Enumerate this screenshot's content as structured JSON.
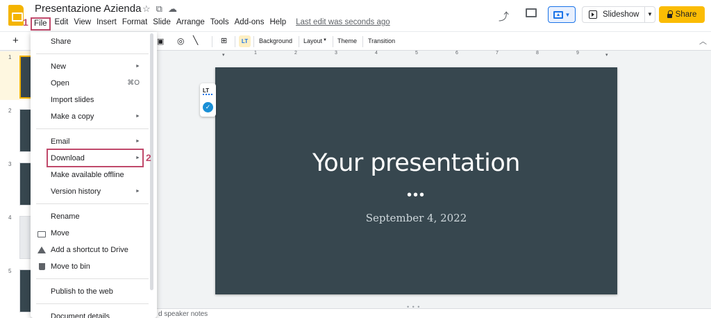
{
  "app": {
    "doc_title": "Presentazione Azienda",
    "last_edit": "Last edit was seconds ago"
  },
  "menubar": {
    "items": [
      "File",
      "Edit",
      "View",
      "Insert",
      "Format",
      "Slide",
      "Arrange",
      "Tools",
      "Add-ons",
      "Help"
    ]
  },
  "annotations": {
    "step1": "1",
    "step2": "2",
    "color": "#c0496b"
  },
  "header_actions": {
    "slideshow_label": "Slideshow",
    "share_label": "Share",
    "share_color": "#fbbc04"
  },
  "toolbar": {
    "add_label": "+",
    "background_label": "Background",
    "layout_label": "Layout",
    "theme_label": "Theme",
    "transition_label": "Transition",
    "lt_label": "LT"
  },
  "ruler": {
    "numbers": [
      "1",
      "2",
      "3",
      "4",
      "5",
      "6",
      "7",
      "8",
      "9"
    ]
  },
  "filmstrip": {
    "slides": [
      "1",
      "2",
      "3",
      "4",
      "5"
    ]
  },
  "file_menu": {
    "share": "Share",
    "new": "New",
    "open": "Open",
    "open_shortcut": "⌘O",
    "import_slides": "Import slides",
    "make_copy": "Make a copy",
    "email": "Email",
    "download": "Download",
    "make_offline": "Make available offline",
    "version_history": "Version history",
    "rename": "Rename",
    "move": "Move",
    "add_shortcut": "Add a shortcut to Drive",
    "move_to_bin": "Move to bin",
    "publish": "Publish to the web",
    "document_details": "Document details"
  },
  "slide": {
    "title": "Your presentation",
    "dots": "•••",
    "date": "September 4, 2022",
    "background_color": "#37474f"
  },
  "language_tool": {
    "logo": "LT",
    "check": "✓"
  },
  "speaker_notes": {
    "text": "d speaker notes"
  }
}
